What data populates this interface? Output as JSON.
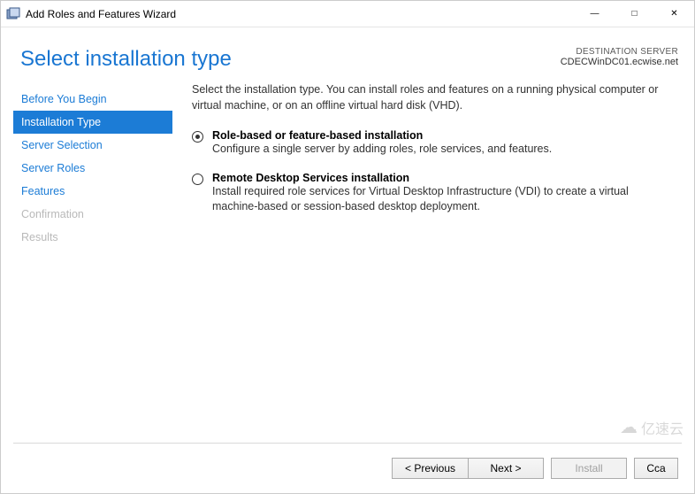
{
  "window": {
    "title": "Add Roles and Features Wizard"
  },
  "header": {
    "page_title": "Select installation type",
    "dest_label": "DESTINATION SERVER",
    "dest_server": "CDECWinDC01.ecwise.net"
  },
  "nav": {
    "items": [
      {
        "label": "Before You Begin",
        "state": "normal"
      },
      {
        "label": "Installation Type",
        "state": "selected"
      },
      {
        "label": "Server Selection",
        "state": "normal"
      },
      {
        "label": "Server Roles",
        "state": "normal"
      },
      {
        "label": "Features",
        "state": "normal"
      },
      {
        "label": "Confirmation",
        "state": "disabled"
      },
      {
        "label": "Results",
        "state": "disabled"
      }
    ]
  },
  "content": {
    "instruction": "Select the installation type. You can install roles and features on a running physical computer or virtual machine, or on an offline virtual hard disk (VHD).",
    "options": [
      {
        "title": "Role-based or feature-based installation",
        "desc": "Configure a single server by adding roles, role services, and features.",
        "checked": true
      },
      {
        "title": "Remote Desktop Services installation",
        "desc": "Install required role services for Virtual Desktop Infrastructure (VDI) to create a virtual machine-based or session-based desktop deployment.",
        "checked": false
      }
    ]
  },
  "footer": {
    "previous": "< Previous",
    "next": "Next >",
    "install": "Install",
    "cancel": "Cca"
  },
  "watermark": "亿速云"
}
